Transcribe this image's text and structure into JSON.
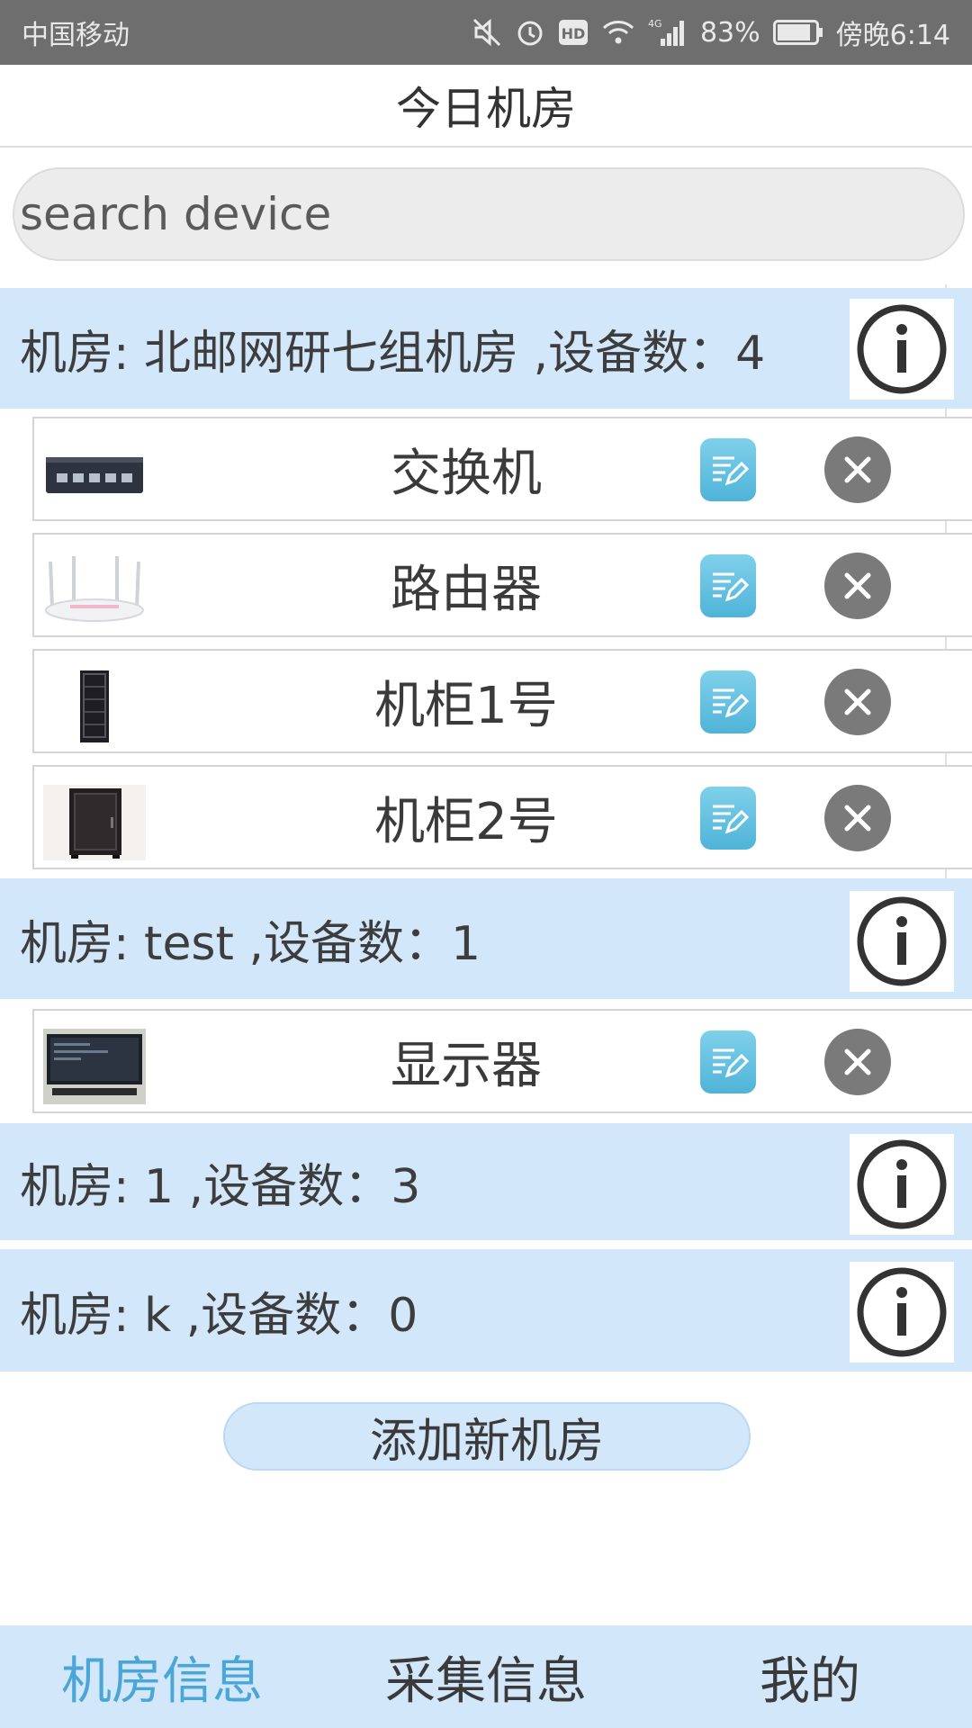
{
  "status_bar": {
    "carrier": "中国移动",
    "battery": "83%",
    "network": "4G",
    "hd": "HD",
    "time": "傍晚6:14"
  },
  "header": {
    "title": "今日机房"
  },
  "search": {
    "placeholder": "search device"
  },
  "rooms": [
    {
      "title": "机房: 北邮网研七组机房 ,设备数：4",
      "devices": [
        {
          "name": "交换机",
          "icon": "switch-thumbnail"
        },
        {
          "name": "路由器",
          "icon": "router-thumbnail"
        },
        {
          "name": "机柜1号",
          "icon": "rack-cabinet-thumbnail"
        },
        {
          "name": "机柜2号",
          "icon": "cabinet-thumbnail"
        }
      ]
    },
    {
      "title": "机房: test ,设备数：1",
      "devices": [
        {
          "name": "显示器",
          "icon": "monitor-thumbnail"
        }
      ]
    },
    {
      "title": "机房: 1 ,设备数：3",
      "devices": []
    },
    {
      "title": "机房: k ,设备数：0",
      "devices": []
    }
  ],
  "actions": {
    "add_room": "添加新机房"
  },
  "bottom_nav": {
    "items": [
      "机房信息",
      "采集信息",
      "我的"
    ],
    "active_index": 0
  },
  "colors": {
    "status_bar": "#6e6e6e",
    "room_header": "#d3e7fb",
    "nav_active": "#4aa6d6",
    "edit_button": "#5cbbe0",
    "delete_button": "#7a7a7a"
  }
}
